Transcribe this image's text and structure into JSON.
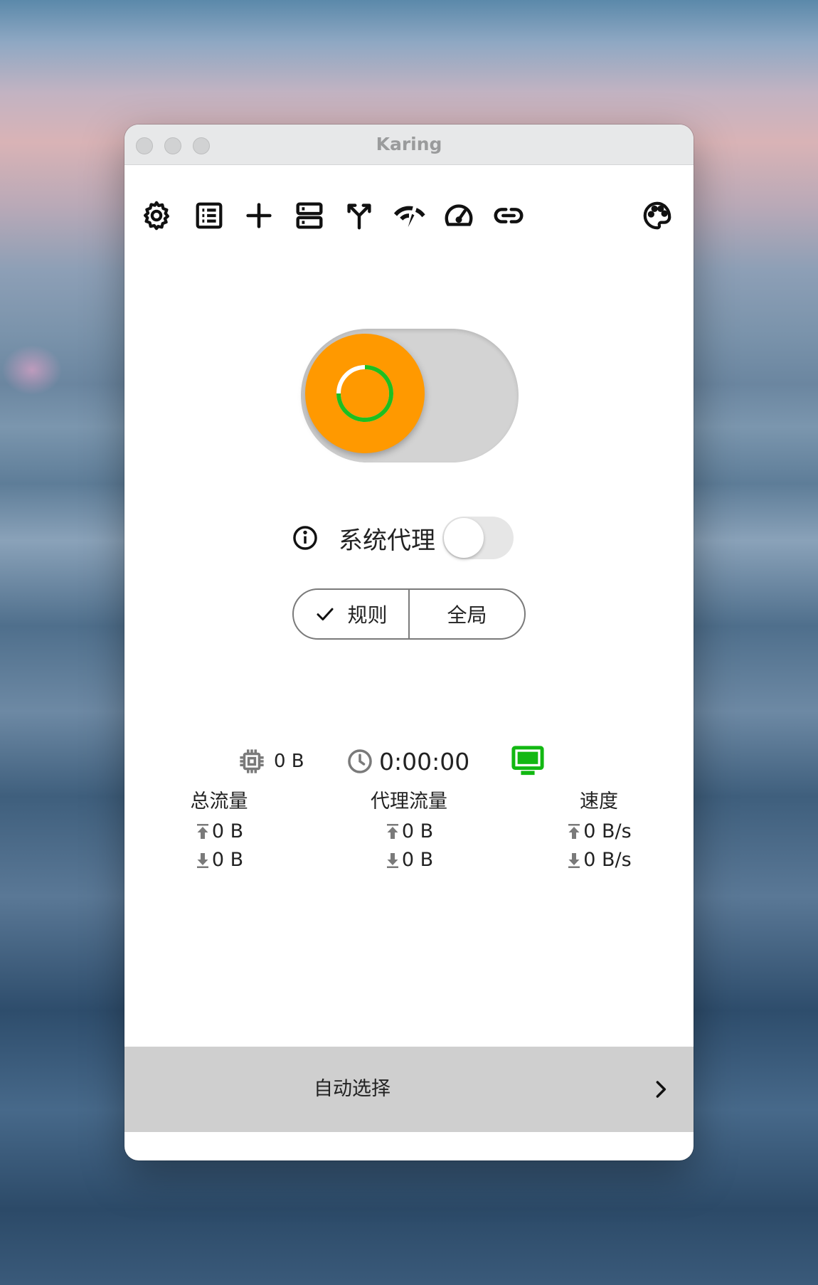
{
  "window": {
    "title": "Karing"
  },
  "toolbar": {
    "icons": [
      "gear-icon",
      "list-icon",
      "add-icon",
      "server-icon",
      "fork-icon",
      "signal-icon",
      "speedometer-icon",
      "link-icon",
      "palette-icon"
    ]
  },
  "main_switch": {
    "state": "connecting",
    "knob_color": "#ff9900",
    "spinner_color": "#1fbf1f"
  },
  "system_proxy": {
    "label": "系统代理",
    "enabled": false
  },
  "mode": {
    "options": [
      "规则",
      "全局"
    ],
    "selected": "规则"
  },
  "status": {
    "memory": "0 B",
    "uptime": "0:00:00",
    "monitor_color": "#12b812"
  },
  "stats": {
    "total": {
      "title": "总流量",
      "up": "0 B",
      "down": "0 B"
    },
    "proxy": {
      "title": "代理流量",
      "up": "0 B",
      "down": "0 B"
    },
    "speed": {
      "title": "速度",
      "up": "0 B/s",
      "down": "0 B/s"
    }
  },
  "selector": {
    "label": "自动选择"
  }
}
